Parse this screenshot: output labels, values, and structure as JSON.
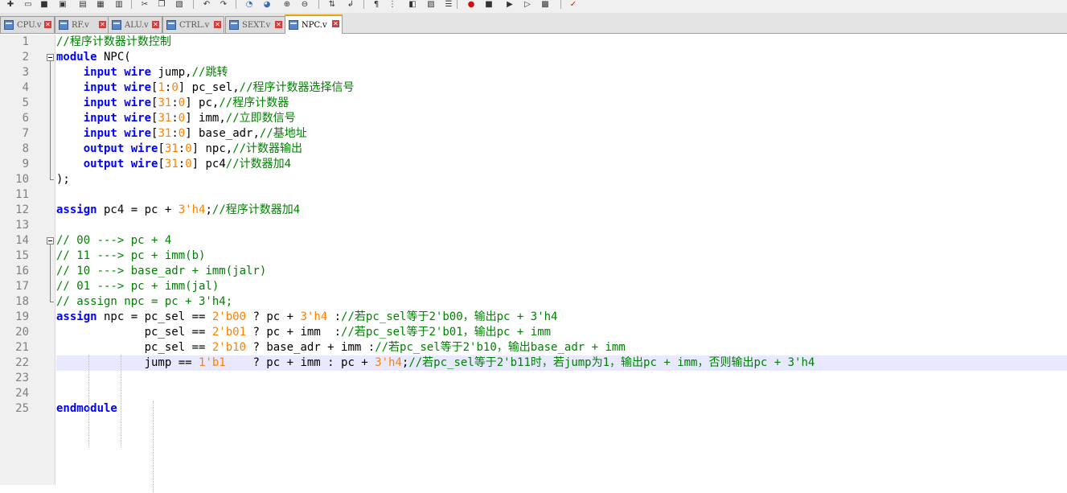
{
  "toolbar": {
    "icons": [
      "new-file",
      "open-file",
      "save",
      "save-all",
      "close",
      "close-all",
      "print",
      "cut",
      "copy",
      "paste",
      "undo",
      "redo",
      "find",
      "replace",
      "zoom-in",
      "zoom-out",
      "sync-scroll",
      "word-wrap",
      "show-all-chars",
      "indent-guide",
      "user-language",
      "doc-map",
      "function-list",
      "record-macro",
      "stop-macro",
      "play-macro",
      "run-macro",
      "save-macro",
      "spell-check"
    ]
  },
  "tabs": [
    {
      "label": "CPU.v"
    },
    {
      "label": "RF.v"
    },
    {
      "label": "ALU.v"
    },
    {
      "label": "CTRL.v"
    },
    {
      "label": "SEXT.v"
    },
    {
      "label": "NPC.v",
      "active": true
    }
  ],
  "editor": {
    "line_numbers": [
      "1",
      "2",
      "3",
      "4",
      "5",
      "6",
      "7",
      "8",
      "9",
      "10",
      "11",
      "12",
      "13",
      "14",
      "15",
      "16",
      "17",
      "18",
      "19",
      "20",
      "21",
      "22",
      "23",
      "24",
      "25"
    ],
    "current_line": "22",
    "lines": [
      [
        {
          "t": "//程序计数器计数控制",
          "s": "c"
        }
      ],
      [
        {
          "t": "module",
          "s": "k"
        },
        {
          "t": " NPC("
        }
      ],
      [
        {
          "t": "    "
        },
        {
          "t": "input",
          "s": "k"
        },
        {
          "t": " "
        },
        {
          "t": "wire",
          "s": "k"
        },
        {
          "t": " jump,"
        },
        {
          "t": "//跳转",
          "s": "c"
        }
      ],
      [
        {
          "t": "    "
        },
        {
          "t": "input",
          "s": "k"
        },
        {
          "t": " "
        },
        {
          "t": "wire",
          "s": "k"
        },
        {
          "t": "["
        },
        {
          "t": "1",
          "s": "n"
        },
        {
          "t": ":"
        },
        {
          "t": "0",
          "s": "n"
        },
        {
          "t": "] pc_sel,"
        },
        {
          "t": "//程序计数器选择信号",
          "s": "c"
        }
      ],
      [
        {
          "t": "    "
        },
        {
          "t": "input",
          "s": "k"
        },
        {
          "t": " "
        },
        {
          "t": "wire",
          "s": "k"
        },
        {
          "t": "["
        },
        {
          "t": "31",
          "s": "n"
        },
        {
          "t": ":"
        },
        {
          "t": "0",
          "s": "n"
        },
        {
          "t": "] pc,"
        },
        {
          "t": "//程序计数器",
          "s": "c"
        }
      ],
      [
        {
          "t": "    "
        },
        {
          "t": "input",
          "s": "k"
        },
        {
          "t": " "
        },
        {
          "t": "wire",
          "s": "k"
        },
        {
          "t": "["
        },
        {
          "t": "31",
          "s": "n"
        },
        {
          "t": ":"
        },
        {
          "t": "0",
          "s": "n"
        },
        {
          "t": "] imm,"
        },
        {
          "t": "//立即数信号",
          "s": "c"
        }
      ],
      [
        {
          "t": "    "
        },
        {
          "t": "input",
          "s": "k"
        },
        {
          "t": " "
        },
        {
          "t": "wire",
          "s": "k"
        },
        {
          "t": "["
        },
        {
          "t": "31",
          "s": "n"
        },
        {
          "t": ":"
        },
        {
          "t": "0",
          "s": "n"
        },
        {
          "t": "] base_adr,"
        },
        {
          "t": "//基地址",
          "s": "c"
        }
      ],
      [
        {
          "t": "    "
        },
        {
          "t": "output",
          "s": "k"
        },
        {
          "t": " "
        },
        {
          "t": "wire",
          "s": "k"
        },
        {
          "t": "["
        },
        {
          "t": "31",
          "s": "n"
        },
        {
          "t": ":"
        },
        {
          "t": "0",
          "s": "n"
        },
        {
          "t": "] npc,"
        },
        {
          "t": "//计数器输出",
          "s": "c"
        }
      ],
      [
        {
          "t": "    "
        },
        {
          "t": "output",
          "s": "k"
        },
        {
          "t": " "
        },
        {
          "t": "wire",
          "s": "k"
        },
        {
          "t": "["
        },
        {
          "t": "31",
          "s": "n"
        },
        {
          "t": ":"
        },
        {
          "t": "0",
          "s": "n"
        },
        {
          "t": "] pc4"
        },
        {
          "t": "//计数器加4",
          "s": "c"
        }
      ],
      [
        {
          "t": ");"
        }
      ],
      [],
      [
        {
          "t": "assign",
          "s": "k"
        },
        {
          "t": " pc4 = pc + "
        },
        {
          "t": "3'h4",
          "s": "n"
        },
        {
          "t": ";"
        },
        {
          "t": "//程序计数器加4",
          "s": "c"
        }
      ],
      [],
      [
        {
          "t": "// 00 ---> pc + 4",
          "s": "c"
        }
      ],
      [
        {
          "t": "// 11 ---> pc + imm(b)",
          "s": "c"
        }
      ],
      [
        {
          "t": "// 10 ---> base_adr + imm(jalr)",
          "s": "c"
        }
      ],
      [
        {
          "t": "// 01 ---> pc + imm(jal)",
          "s": "c"
        }
      ],
      [
        {
          "t": "// assign npc = pc + 3'h4;",
          "s": "c"
        }
      ],
      [
        {
          "t": "assign",
          "s": "k"
        },
        {
          "t": " npc = pc_sel == "
        },
        {
          "t": "2'b00",
          "s": "n"
        },
        {
          "t": " ? pc + "
        },
        {
          "t": "3'h4",
          "s": "n"
        },
        {
          "t": " :"
        },
        {
          "t": "//若pc_sel等于2'b00，输出pc + 3'h4",
          "s": "c"
        }
      ],
      [
        {
          "t": "             pc_sel == "
        },
        {
          "t": "2'b01",
          "s": "n"
        },
        {
          "t": " ? pc + imm  :"
        },
        {
          "t": "//若pc_sel等于2'b01，输出pc + imm",
          "s": "c"
        }
      ],
      [
        {
          "t": "             pc_sel == "
        },
        {
          "t": "2'b10",
          "s": "n"
        },
        {
          "t": " ? base_adr + imm :"
        },
        {
          "t": "//若pc_sel等于2'b10，输出base_adr + imm",
          "s": "c"
        }
      ],
      [
        {
          "t": "             jump == "
        },
        {
          "t": "1'b1",
          "s": "n"
        },
        {
          "t": "    ? pc + imm : pc + "
        },
        {
          "t": "3'h4",
          "s": "n"
        },
        {
          "t": ";"
        },
        {
          "t": "//若pc_sel等于2'b11时，若jump为1，输出pc + imm，否则输出pc + 3'h4",
          "s": "c"
        }
      ],
      [],
      [],
      [
        {
          "t": "endmodule",
          "s": "k"
        }
      ]
    ]
  }
}
